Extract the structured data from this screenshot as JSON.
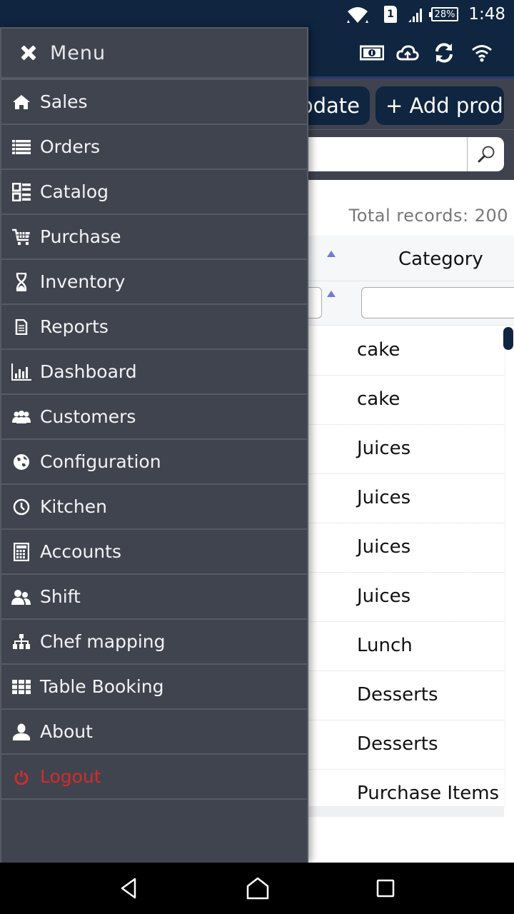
{
  "status_bar": {
    "time": "1:48",
    "battery_percent": "28%",
    "sim_slot": "1",
    "icons": [
      "wifi-icon",
      "sim-icon",
      "signal-icon",
      "battery-icon"
    ]
  },
  "app_header": {
    "icons": [
      "cash-icon",
      "cloud-upload-icon",
      "sync-icon",
      "wifi-icon"
    ]
  },
  "toolbar": {
    "update_label": "Update",
    "add_product_label": "+ Add product"
  },
  "search": {
    "value": "",
    "placeholder": "",
    "button_icon": "search-icon"
  },
  "table": {
    "total_records": "Total records: 200",
    "columns": [
      {
        "header": "Category",
        "sort": "ascending"
      }
    ],
    "rows": [
      {
        "category": "cake"
      },
      {
        "category": "cake"
      },
      {
        "category": "Juices"
      },
      {
        "category": "Juices"
      },
      {
        "category": "Juices"
      },
      {
        "category": "Juices"
      },
      {
        "category": "Lunch"
      },
      {
        "category": "Desserts"
      },
      {
        "category": "Desserts"
      },
      {
        "category": "Purchase Items"
      }
    ]
  },
  "drawer": {
    "title": "Menu",
    "close_icon": "close-icon",
    "items": [
      {
        "label": "Sales",
        "icon": "home-icon"
      },
      {
        "label": "Orders",
        "icon": "list-icon"
      },
      {
        "label": "Catalog",
        "icon": "catalog-icon"
      },
      {
        "label": "Purchase",
        "icon": "cart-icon"
      },
      {
        "label": "Inventory",
        "icon": "hourglass-icon"
      },
      {
        "label": "Reports",
        "icon": "document-icon"
      },
      {
        "label": "Dashboard",
        "icon": "bar-chart-icon"
      },
      {
        "label": "Customers",
        "icon": "group-icon"
      },
      {
        "label": "Configuration",
        "icon": "globe-icon"
      },
      {
        "label": "Kitchen",
        "icon": "clock-icon"
      },
      {
        "label": "Accounts",
        "icon": "calculator-icon"
      },
      {
        "label": "Shift",
        "icon": "users-icon"
      },
      {
        "label": "Chef mapping",
        "icon": "sitemap-icon"
      },
      {
        "label": "Table Booking",
        "icon": "grid-icon"
      },
      {
        "label": "About",
        "icon": "user-icon"
      },
      {
        "label": "Logout",
        "icon": "power-icon"
      }
    ]
  },
  "colors": {
    "header_bg": "#0f2540",
    "drawer_bg": "#40444f",
    "divider": "#565a65",
    "logout": "#d42b2b",
    "sort_arrow": "#7678d8"
  },
  "nav_bar": {
    "buttons": [
      "back-icon",
      "home-icon",
      "recents-icon"
    ]
  }
}
